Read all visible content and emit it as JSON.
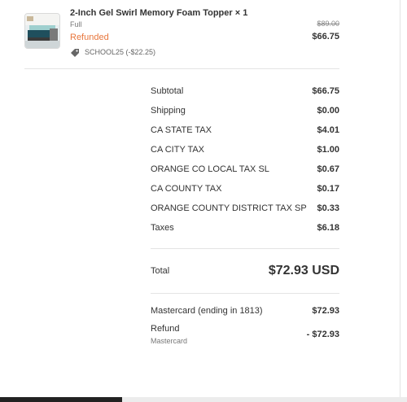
{
  "product": {
    "title": "2-Inch Gel Swirl Memory Foam Topper × 1",
    "variant": "Full",
    "status": "Refunded",
    "discount_code": "SCHOOL25 (-$22.25)",
    "original_price": "$89.00",
    "final_price": "$66.75",
    "status_color": "#e8763c",
    "thumbnail_icon": "mattress-topper-image",
    "discount_icon": "tag-icon"
  },
  "summary": {
    "rows": [
      {
        "label": "Subtotal",
        "value": "$66.75"
      },
      {
        "label": "Shipping",
        "value": "$0.00"
      },
      {
        "label": "CA STATE TAX",
        "value": "$4.01"
      },
      {
        "label": "CA CITY TAX",
        "value": "$1.00"
      },
      {
        "label": "ORANGE CO LOCAL TAX SL",
        "value": "$0.67"
      },
      {
        "label": "CA COUNTY TAX",
        "value": "$0.17"
      },
      {
        "label": "ORANGE COUNTY DISTRICT TAX SP",
        "value": "$0.33"
      },
      {
        "label": "Taxes",
        "value": "$6.18"
      }
    ]
  },
  "total": {
    "label": "Total",
    "amount": "$72.93 USD"
  },
  "payments": {
    "card_label": "Mastercard (ending in 1813)",
    "card_amount": "$72.93",
    "refund_label": "Refund",
    "refund_sub": "Mastercard",
    "refund_amount": "- $72.93"
  }
}
